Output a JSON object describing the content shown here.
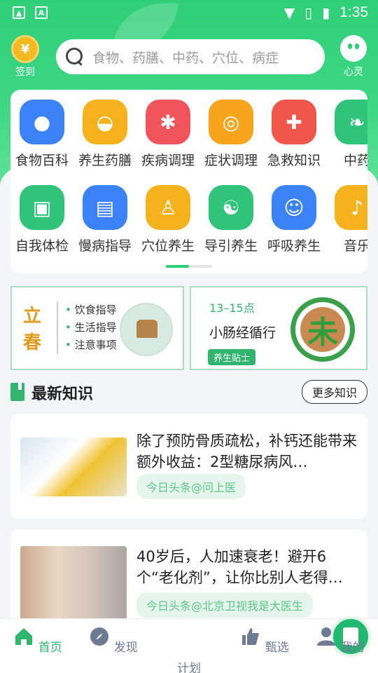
{
  "status_bar": {
    "time": "1:35"
  },
  "header": {
    "signin_label": "签到",
    "signin_coin": "¥",
    "search_placeholder": "食物、药膳、中药、穴位、病症",
    "xinling_label": "心灵"
  },
  "categories": {
    "row1": [
      {
        "label": "食物百科",
        "color": "#3b82f6"
      },
      {
        "label": "养生药膳",
        "color": "#f6b21c"
      },
      {
        "label": "疾病调理",
        "color": "#f2545b"
      },
      {
        "label": "症状调理",
        "color": "#f6a51c"
      },
      {
        "label": "急救知识",
        "color": "#f0574a"
      },
      {
        "label": "中药",
        "color": "#2fc47a"
      }
    ],
    "row2": [
      {
        "label": "自我体检",
        "color": "#2fc47a"
      },
      {
        "label": "慢病指导",
        "color": "#3b82f6"
      },
      {
        "label": "穴位养生",
        "color": "#f6b21c"
      },
      {
        "label": "导引养生",
        "color": "#2fc47a"
      },
      {
        "label": "呼吸养生",
        "color": "#3b82f6"
      },
      {
        "label": "音乐",
        "color": "#f6b21c"
      }
    ]
  },
  "banner_left": {
    "title": "立春",
    "items": [
      "饮食指导",
      "生活指导",
      "注意事项"
    ]
  },
  "banner_right": {
    "time": "13–15点",
    "meridian": "小肠经循行",
    "tag": "养生贴士",
    "badge": "未"
  },
  "section": {
    "title": "最新知识",
    "more": "更多知识"
  },
  "news": [
    {
      "title": "除了预防骨质疏松，补钙还能带来额外收益：2型糖尿病风…",
      "source": "今日头条@问上医"
    },
    {
      "title": "40岁后，人加速衰老！避开6个“老化剂”，让你比别人老得…",
      "source": "今日头条@北京卫视我是大医生"
    }
  ],
  "tabs": [
    "首页",
    "发现",
    "计划",
    "甄选",
    "我的"
  ]
}
